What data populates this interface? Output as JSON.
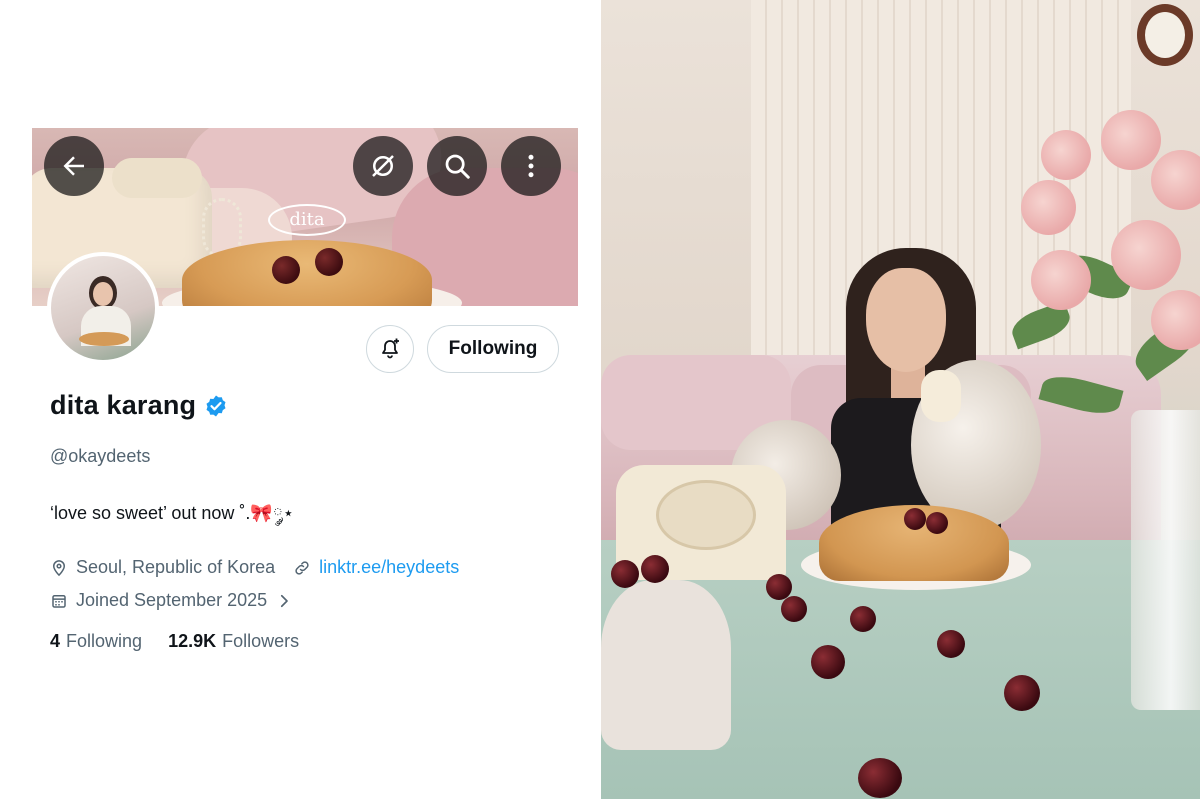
{
  "profile": {
    "display_name": "dita karang",
    "handle": "@okaydeets",
    "bio": "‘love so sweet’ out now ˚.🎀༘⋆",
    "location": "Seoul, Republic of Korea",
    "link": "linktr.ee/heydeets",
    "joined": "Joined September 2025",
    "following_count": "4",
    "following_label": "Following",
    "followers_count": "12.9K",
    "followers_label": "Followers",
    "banner_logo": "dita"
  },
  "actions": {
    "follow_label": "Following"
  },
  "icons": {
    "back": "back-arrow-icon",
    "grok": "grok-icon",
    "search": "search-icon",
    "more": "more-vertical-icon",
    "notify": "bell-plus-icon",
    "verified": "verified-badge-icon",
    "location": "location-pin-icon",
    "link": "link-icon",
    "calendar": "calendar-icon",
    "chevron": "chevron-right-icon"
  },
  "colors": {
    "accent": "#1d9bf0",
    "text_primary": "#0f1419",
    "text_secondary": "#536471",
    "border": "#cfd9de"
  }
}
